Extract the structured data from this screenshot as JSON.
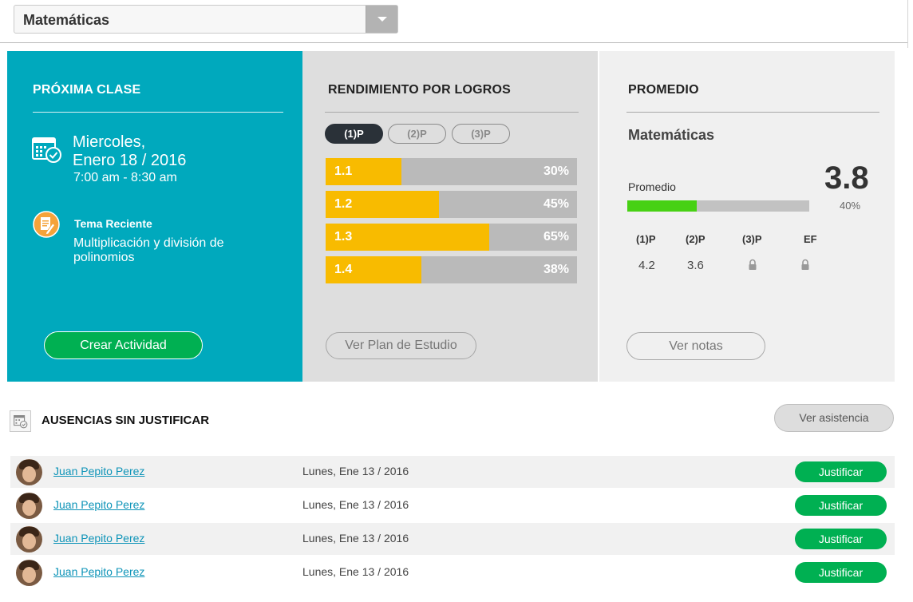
{
  "subject_selector": {
    "value": "Matemáticas"
  },
  "next_class": {
    "title": "PRÓXIMA CLASE",
    "date_line1": "Miercoles,",
    "date_line2": "Enero 18 / 2016",
    "time": "7:00 am - 8:30 am",
    "topic_label": "Tema Reciente",
    "topic": "Multiplicación y división de polinomios",
    "create_button": "Crear Actividad"
  },
  "performance": {
    "title": "RENDIMIENTO POR LOGROS",
    "periods": [
      {
        "label": "(1)P",
        "active": true
      },
      {
        "label": "(2)P",
        "active": false
      },
      {
        "label": "(3)P",
        "active": false
      }
    ],
    "achievements": [
      {
        "label": "1.1",
        "percent": 30,
        "percent_text": "30%"
      },
      {
        "label": "1.2",
        "percent": 45,
        "percent_text": "45%"
      },
      {
        "label": "1.3",
        "percent": 65,
        "percent_text": "65%"
      },
      {
        "label": "1.4",
        "percent": 38,
        "percent_text": "38%"
      }
    ],
    "plan_button": "Ver Plan de Estudio"
  },
  "average": {
    "title": "PROMEDIO",
    "subject": "Matemáticas",
    "label": "Promedio",
    "value": "3.8",
    "progress_percent": 40,
    "progress_text": "40%",
    "grade_headers": [
      "(1)P",
      "(2)P",
      "(3)P",
      "EF"
    ],
    "grades": [
      "4.2",
      "3.6",
      "",
      ""
    ],
    "locked": [
      false,
      false,
      true,
      true
    ],
    "notes_button": "Ver notas"
  },
  "absences": {
    "title": "AUSENCIAS SIN JUSTIFICAR",
    "attendance_button": "Ver asistencia",
    "rows": [
      {
        "name": "Juan Pepito Perez",
        "date": "Lunes, Ene 13 / 2016",
        "action": "Justificar"
      },
      {
        "name": "Juan Pepito Perez",
        "date": "Lunes, Ene 13 / 2016",
        "action": "Justificar"
      },
      {
        "name": "Juan Pepito Perez",
        "date": "Lunes, Ene 13 / 2016",
        "action": "Justificar"
      },
      {
        "name": "Juan Pepito Perez",
        "date": "Lunes, Ene 13 / 2016",
        "action": "Justificar"
      }
    ]
  },
  "colors": {
    "teal_panel": "#00a9bd",
    "green_button": "#00b052",
    "yellow_bar": "#f8bb00",
    "green_progress": "#47d114",
    "link": "#0e94b8"
  }
}
